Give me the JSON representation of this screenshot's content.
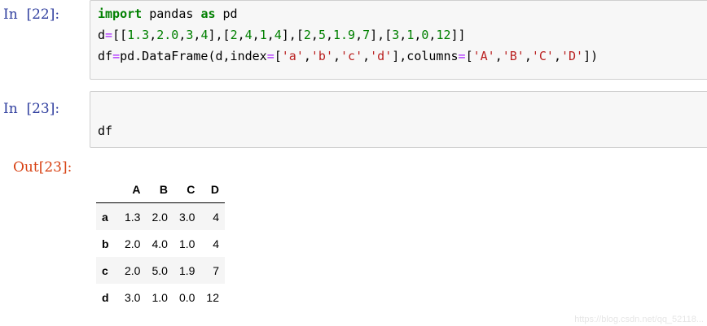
{
  "cells": [
    {
      "prompt": "In  [22]:",
      "lines": [
        [
          {
            "t": "import",
            "c": "kw"
          },
          {
            "t": " pandas ",
            "c": ""
          },
          {
            "t": "as",
            "c": "kw"
          },
          {
            "t": " pd",
            "c": ""
          }
        ],
        [
          {
            "t": "d",
            "c": ""
          },
          {
            "t": "=",
            "c": "op"
          },
          {
            "t": "[[",
            "c": ""
          },
          {
            "t": "1.3",
            "c": "num"
          },
          {
            "t": ",",
            "c": ""
          },
          {
            "t": "2.0",
            "c": "num"
          },
          {
            "t": ",",
            "c": ""
          },
          {
            "t": "3",
            "c": "num"
          },
          {
            "t": ",",
            "c": ""
          },
          {
            "t": "4",
            "c": "num"
          },
          {
            "t": "],[",
            "c": ""
          },
          {
            "t": "2",
            "c": "num"
          },
          {
            "t": ",",
            "c": ""
          },
          {
            "t": "4",
            "c": "num"
          },
          {
            "t": ",",
            "c": ""
          },
          {
            "t": "1",
            "c": "num"
          },
          {
            "t": ",",
            "c": ""
          },
          {
            "t": "4",
            "c": "num"
          },
          {
            "t": "],[",
            "c": ""
          },
          {
            "t": "2",
            "c": "num"
          },
          {
            "t": ",",
            "c": ""
          },
          {
            "t": "5",
            "c": "num"
          },
          {
            "t": ",",
            "c": ""
          },
          {
            "t": "1.9",
            "c": "num"
          },
          {
            "t": ",",
            "c": ""
          },
          {
            "t": "7",
            "c": "num"
          },
          {
            "t": "],[",
            "c": ""
          },
          {
            "t": "3",
            "c": "num"
          },
          {
            "t": ",",
            "c": ""
          },
          {
            "t": "1",
            "c": "num"
          },
          {
            "t": ",",
            "c": ""
          },
          {
            "t": "0",
            "c": "num"
          },
          {
            "t": ",",
            "c": ""
          },
          {
            "t": "12",
            "c": "num"
          },
          {
            "t": "]]",
            "c": ""
          }
        ],
        [
          {
            "t": "df",
            "c": ""
          },
          {
            "t": "=",
            "c": "op"
          },
          {
            "t": "pd.DataFrame(d,index",
            "c": ""
          },
          {
            "t": "=",
            "c": "op"
          },
          {
            "t": "[",
            "c": ""
          },
          {
            "t": "'a'",
            "c": "str"
          },
          {
            "t": ",",
            "c": ""
          },
          {
            "t": "'b'",
            "c": "str"
          },
          {
            "t": ",",
            "c": ""
          },
          {
            "t": "'c'",
            "c": "str"
          },
          {
            "t": ",",
            "c": ""
          },
          {
            "t": "'d'",
            "c": "str"
          },
          {
            "t": "],columns",
            "c": ""
          },
          {
            "t": "=",
            "c": "op"
          },
          {
            "t": "[",
            "c": ""
          },
          {
            "t": "'A'",
            "c": "str"
          },
          {
            "t": ",",
            "c": ""
          },
          {
            "t": "'B'",
            "c": "str"
          },
          {
            "t": ",",
            "c": ""
          },
          {
            "t": "'C'",
            "c": "str"
          },
          {
            "t": ",",
            "c": ""
          },
          {
            "t": "'D'",
            "c": "str"
          },
          {
            "t": "])",
            "c": ""
          }
        ]
      ]
    },
    {
      "prompt": "In  [23]:",
      "lines": [
        [
          {
            "t": "df",
            "c": ""
          }
        ]
      ]
    }
  ],
  "output": {
    "prompt": "Out[23]:",
    "columns": [
      "",
      "A",
      "B",
      "C",
      "D"
    ],
    "rows": [
      {
        "index": "a",
        "values": [
          "1.3",
          "2.0",
          "3.0",
          "4"
        ]
      },
      {
        "index": "b",
        "values": [
          "2.0",
          "4.0",
          "1.0",
          "4"
        ]
      },
      {
        "index": "c",
        "values": [
          "2.0",
          "5.0",
          "1.9",
          "7"
        ]
      },
      {
        "index": "d",
        "values": [
          "3.0",
          "1.0",
          "0.0",
          "12"
        ]
      }
    ]
  },
  "watermark": "https://blog.csdn.net/qq_52118...",
  "colors": {
    "input_prompt": "#303f9f",
    "output_prompt": "#d84315",
    "keyword": "#008000",
    "number": "#008000",
    "string": "#ba2121",
    "operator": "#aa22ff",
    "cell_background": "#f7f7f7",
    "cell_border": "#cfcfcf"
  }
}
